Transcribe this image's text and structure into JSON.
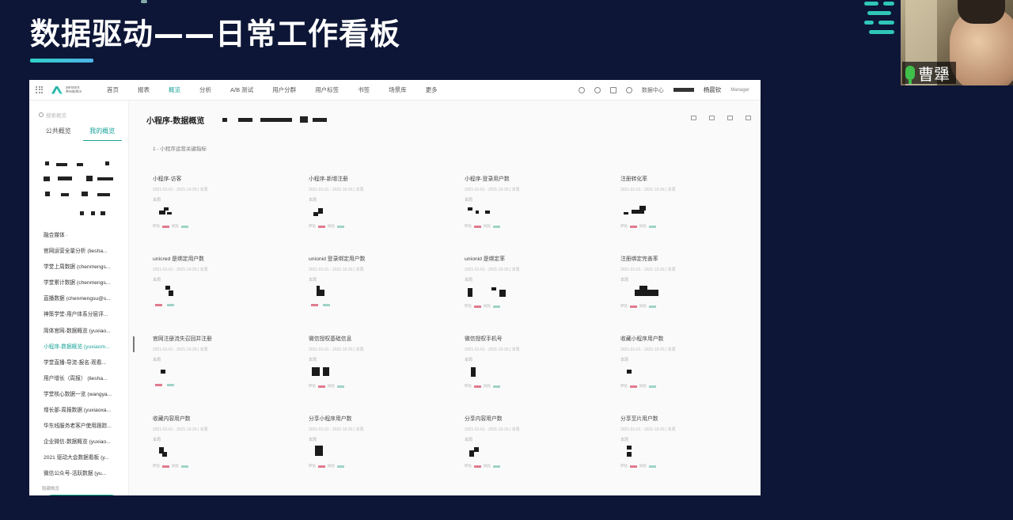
{
  "slide": {
    "title": "数据驱动——日常工作看板"
  },
  "participant": {
    "name": "曹犟"
  },
  "colors": {
    "accent": "#1aa39a",
    "slide_bg": "#0d1636",
    "brand_teal": "#2fc6b9"
  },
  "app": {
    "logo_text": "sensors Analytics",
    "nav": [
      "首页",
      "报表",
      "概览",
      "分析",
      "A/B 测试",
      "用户分群",
      "用户标签",
      "书签",
      "场景库",
      "更多"
    ],
    "top_right": {
      "center": "数据中心",
      "user": "杨晨钦",
      "role": "Manager"
    }
  },
  "sidebar": {
    "search_placeholder": "搜索概览",
    "tabs": [
      "公共概览",
      "我的概览"
    ],
    "items": [
      "融合媒体 ·",
      "官网运营全量分析 (liesha...",
      "学堂上周数据 (chenmengs...",
      "学堂累计数据 (chenmengs...",
      "直播数据 (chenmengsu@s...",
      "神策学堂-用户体系分层评...",
      "简体官网-数据概览 (yuxiao...",
      "小程序-数据概览 (yuxiaom...",
      "学堂直播-导流-报名-观看...",
      "用户增长（周报） (liesha...",
      "学堂核心数据一览 (wangya...",
      "增长部-周报数据 (yuxiaoxa...",
      "华东线服务老客户使用跟踪...",
      "企业微信-数据概览 (yuxiao...",
      "2021 驱动大会数据看板 (y...",
      "微信公众号-活跃数据 (yu..."
    ],
    "footer": "隐藏概览",
    "actions": [
      "+",
      "≡",
      "<"
    ]
  },
  "main": {
    "page_title": "小程序-数据概览",
    "section_title": "1 - 小程序运营关键指标",
    "cards": [
      {
        "title": "小程序-访客",
        "date": "2021-01-01 - 2021-10-26 | 本周",
        "sub": "本周",
        "legend": [
          "环比",
          "同比"
        ]
      },
      {
        "title": "小程序-新增注册",
        "date": "2021-01-01 - 2021-10-26 | 本周",
        "sub": "本周",
        "legend": [
          "环比",
          "同比"
        ]
      },
      {
        "title": "小程序-登录用户数",
        "date": "2021-01-01 - 2021-10-26 | 本周",
        "sub": "本周",
        "legend": [
          "环比",
          "同比"
        ]
      },
      {
        "title": "注册转化率",
        "date": "2021-01-01 - 2021-10-26 | 本周",
        "sub": "",
        "legend": [
          "环比",
          "同比"
        ]
      },
      {
        "title": "unicred 是绑定用户数",
        "date": "2021-01-01 - 2021-10-26 | 本周",
        "sub": "本周",
        "legend": [
          "",
          ""
        ]
      },
      {
        "title": "unionid 登录绑定用户数",
        "date": "2021-01-01 - 2021-10-26 | 本周",
        "sub": "本周",
        "legend": [
          "",
          ""
        ]
      },
      {
        "title": "unionid 是绑定率",
        "date": "2021-01-01 - 2021-10-26 | 本周",
        "sub": "本周",
        "legend": [
          "环比",
          "同比"
        ]
      },
      {
        "title": "注册绑定完善率",
        "date": "2021-01-01 - 2021-10-26 | 本周",
        "sub": "本周",
        "legend": [
          "环比",
          "同比"
        ]
      },
      {
        "title": "官网注册流失召回并注册",
        "date": "2021-01-01 - 2021-10-26 | 本周",
        "sub": "本周",
        "legend": [
          "",
          ""
        ]
      },
      {
        "title": "微信授权基础信息",
        "date": "2021-01-01 - 2021-10-26 | 本周",
        "sub": "本周",
        "legend": [
          "环比",
          "同比"
        ]
      },
      {
        "title": "微信授权手机号",
        "date": "2021-01-01 - 2021-10-26 | 本周",
        "sub": "本周",
        "legend": [
          "环比",
          "同比"
        ]
      },
      {
        "title": "收藏小程序用户数",
        "date": "2021-01-01 - 2021-10-26 | 本周",
        "sub": "本周",
        "legend": [
          "环比",
          "同比"
        ]
      },
      {
        "title": "收藏内容用户数",
        "date": "2021-01-01 - 2021-10-26 | 本周",
        "sub": "本周",
        "legend": [
          "环比",
          "同比"
        ]
      },
      {
        "title": "分享小程序用户数",
        "date": "2021-01-01 - 2021-10-26 | 本周",
        "sub": "本周",
        "legend": [
          "环比",
          "同比"
        ]
      },
      {
        "title": "分享内容用户数",
        "date": "2021-01-01 - 2021-10-26 | 本周",
        "sub": "本周",
        "legend": [
          "环比",
          "同比"
        ]
      },
      {
        "title": "分享至片用户数",
        "date": "2021-01-01 - 2021-10-26 | 本周",
        "sub": "本周",
        "legend": [
          "环比",
          "同比"
        ]
      }
    ]
  }
}
